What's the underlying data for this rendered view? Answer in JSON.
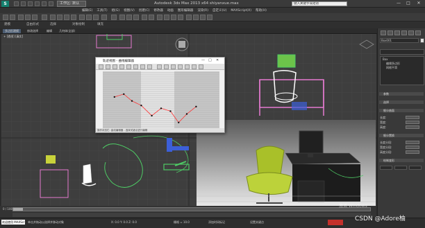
{
  "app": {
    "logo": "S",
    "workspace": "工作区: 默认",
    "title": "Autodesk 3ds Max  2013 x64      shiyanxue.max",
    "search_placeholder": "键入关键字或短语",
    "win_min": "—",
    "win_max": "□",
    "win_close": "✕"
  },
  "menu": [
    "编辑(E)",
    "工具(T)",
    "组(G)",
    "视图(V)",
    "创建(C)",
    "修改器",
    "动画",
    "图形编辑器",
    "渲染(R)",
    "自定义(U)",
    "MAXScript(X)",
    "帮助(H)"
  ],
  "ribbon": {
    "tabs": [
      "建模",
      "自由形式",
      "选择",
      "对象绘制",
      "填充"
    ],
    "subtabs": [
      "多边形建模",
      "修改选择",
      "编辑",
      "几何体(全部)"
    ]
  },
  "viewport": {
    "label": "+ [透视] [真实]"
  },
  "curve_editor": {
    "title": "轨迹视图 - 曲线编辑器",
    "status": "操作状态栏: 曲线编辑器 - 选择关键点进行编辑",
    "keys": [
      {
        "t": 0.1,
        "v": 0.55
      },
      {
        "t": 0.18,
        "v": 0.6
      },
      {
        "t": 0.25,
        "v": 0.48
      },
      {
        "t": 0.33,
        "v": 0.4
      },
      {
        "t": 0.42,
        "v": 0.22
      },
      {
        "t": 0.5,
        "v": 0.35
      },
      {
        "t": 0.58,
        "v": 0.3
      },
      {
        "t": 0.65,
        "v": 0.1
      },
      {
        "t": 0.72,
        "v": 0.25
      },
      {
        "t": 0.8,
        "v": 0.38
      }
    ]
  },
  "command_panel": {
    "object_name": "Box001",
    "modifier_stack": [
      "Box",
      "编辑多边形",
      "网格平滑"
    ],
    "rollouts": [
      "参数",
      "选择",
      "细分曲面",
      "细分置换",
      "绘制变形"
    ],
    "params": [
      {
        "label": "长度:",
        "value": "0.0"
      },
      {
        "label": "宽度:",
        "value": "0.0"
      },
      {
        "label": "高度:",
        "value": "0.0"
      },
      {
        "label": "长度分段:",
        "value": "1"
      },
      {
        "label": "宽度分段:",
        "value": "1"
      },
      {
        "label": "高度分段:",
        "value": "1"
      }
    ]
  },
  "status": {
    "welcome": "欢迎使用 MAXScript。",
    "prompt": "单击并拖动以选择并移动对象",
    "frame": "0 / 100",
    "coords": "X: 0.0  Y: 0.0  Z: 0.0",
    "grid": "栅格 = 10.0",
    "add_time_tag": "添加时间标记",
    "set_key": "设置关键点",
    "activate_windows": "激活 Windows",
    "watermark": "CSDN @Adore柚"
  },
  "colors": {
    "accent": "#4c5d73",
    "teal_logo": "#15806f",
    "pink_wire": "#e57ad0",
    "yellow_chair": "#c8d23a",
    "green_wire": "#4ecb65",
    "blue_wire": "#3c5fd8"
  }
}
